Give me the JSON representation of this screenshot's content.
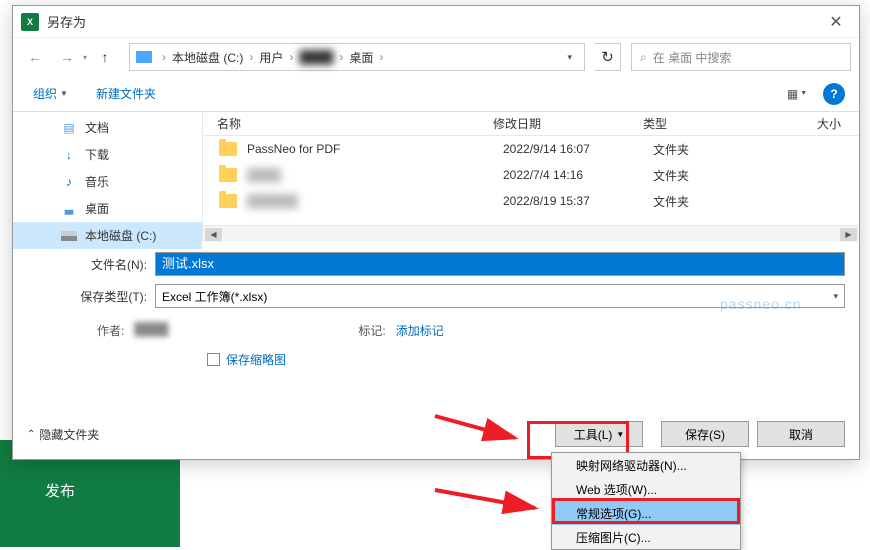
{
  "window": {
    "title": "另存为",
    "close": "✕"
  },
  "nav": {
    "back": "←",
    "forward": "→",
    "up": "↑",
    "refresh": "↻"
  },
  "breadcrumb": {
    "root": "本地磁盘 (C:)",
    "users": "用户",
    "user": "████",
    "desktop": "桌面"
  },
  "search": {
    "placeholder": "在 桌面 中搜索"
  },
  "toolbar": {
    "organize": "组织",
    "newfolder": "新建文件夹",
    "help": "?"
  },
  "sidebar": [
    {
      "label": "文档",
      "icon": "doc"
    },
    {
      "label": "下载",
      "icon": "download"
    },
    {
      "label": "音乐",
      "icon": "music"
    },
    {
      "label": "桌面",
      "icon": "desktop"
    },
    {
      "label": "本地磁盘 (C:)",
      "icon": "drive",
      "selected": true
    }
  ],
  "columns": {
    "name": "名称",
    "date": "修改日期",
    "type": "类型",
    "size": "大小"
  },
  "files": [
    {
      "name": "PassNeo for PDF",
      "date": "2022/9/14 16:07",
      "type": "文件夹"
    },
    {
      "name": "████",
      "date": "2022/7/4 14:16",
      "type": "文件夹",
      "blur": true
    },
    {
      "name": "██████",
      "date": "2022/8/19 15:37",
      "type": "文件夹",
      "blur": true
    }
  ],
  "form": {
    "filename_label": "文件名(N):",
    "filename_value": "测试.xlsx",
    "savetype_label": "保存类型(T):",
    "savetype_value": "Excel 工作簿(*.xlsx)",
    "author_label": "作者:",
    "author_value": "████",
    "tags_label": "标记:",
    "tags_value": "添加标记",
    "thumbnail_label": "保存缩略图"
  },
  "footer": {
    "hide_folders": "隐藏文件夹",
    "tools": "工具(L)",
    "save": "保存(S)",
    "cancel": "取消"
  },
  "dropdown": [
    {
      "label": "映射网络驱动器(N)..."
    },
    {
      "label": "Web 选项(W)..."
    },
    {
      "label": "常规选项(G)...",
      "highlighted": true
    },
    {
      "label": "压缩图片(C)..."
    }
  ],
  "watermark": "passneo.cn",
  "excel": {
    "publish": "发布"
  }
}
